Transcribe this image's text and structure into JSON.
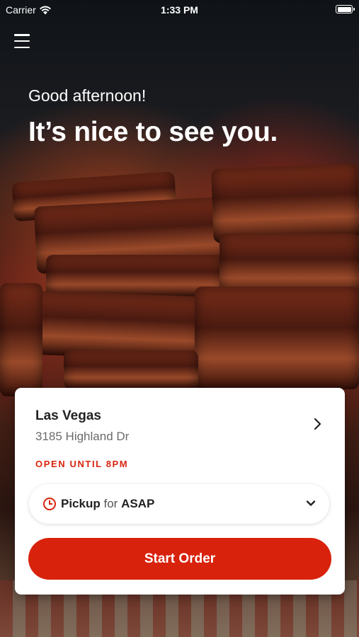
{
  "status_bar": {
    "carrier": "Carrier",
    "time": "1:33 PM"
  },
  "header": {
    "greeting": "Good afternoon!",
    "headline": "It’s nice to see you."
  },
  "store": {
    "name": "Las Vegas",
    "address": "3185 Highland Dr",
    "hours": "OPEN UNTIL 8PM"
  },
  "order_mode": {
    "method": "Pickup",
    "connector": "for",
    "timing": "ASAP"
  },
  "actions": {
    "start_order": "Start Order"
  },
  "colors": {
    "accent": "#d8220c",
    "hours_text": "#d92410"
  },
  "icons": {
    "menu": "hamburger-icon",
    "wifi": "wifi-icon",
    "battery": "battery-icon",
    "store_chevron": "chevron-right-icon",
    "clock": "clock-icon",
    "dropdown": "chevron-down-icon"
  }
}
